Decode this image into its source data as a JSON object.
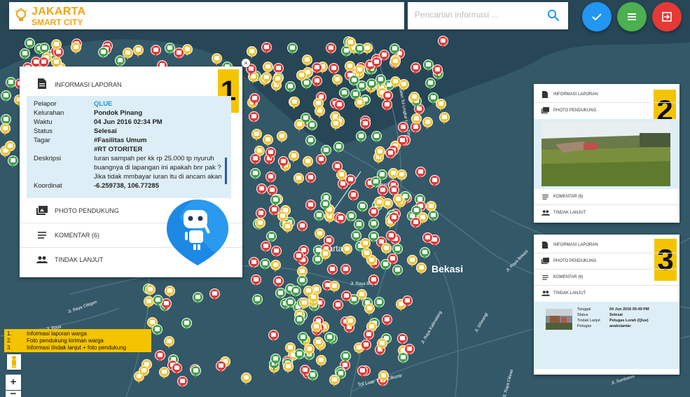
{
  "brand": {
    "title": "JAKARTA",
    "subtitle": "SMART CITY"
  },
  "search": {
    "placeholder": "Pencarian informasi ..."
  },
  "fabs": [
    {
      "name": "check-fab",
      "color": "#2196f3"
    },
    {
      "name": "menu-fab",
      "color": "#4caf50"
    },
    {
      "name": "logout-fab",
      "color": "#e53935"
    }
  ],
  "map_labels": {
    "city_center": "Jakarta",
    "bekasi": "Bekasi",
    "road_1": "Jl. Raya",
    "road_2": "Jl. Raya Bogor",
    "road_3": "Jl. Raya Cilegon",
    "road_4": "Tol Luar TMII-Cikunir",
    "road_5": "Jl. Raya Kalimalang",
    "road_6": "Jl. Sumbawa",
    "road_7": "Jl. Raya",
    "road_8": "Jl. Siliwangi",
    "road_9": "Jalan Tol Lingkar Luar Timur",
    "road_10": "Jl. Raya Bekasi",
    "road_11": "Jl. Raya Cikeas"
  },
  "popup": {
    "badge": "1",
    "header": "INFORMASI LAPORAN",
    "fields": [
      {
        "key": "Pelapor",
        "value": "QLUE"
      },
      {
        "key": "Kelurahan",
        "value": "Pondok Pinang"
      },
      {
        "key": "Waktu",
        "value": "04 Jun 2016 02:34 PM"
      },
      {
        "key": "Status",
        "value": "Selesai"
      },
      {
        "key": "Tagar",
        "value": "#Fasilitas Umum"
      },
      {
        "key": "",
        "value": "#RT OTORITER"
      },
      {
        "key": "Deskripsi",
        "value": "Iuran sampah per kk rp 25.000 tp nyuruh"
      },
      {
        "key": "",
        "value": "buangnya di lapangan ini apakah bnr pak ?"
      },
      {
        "key": "",
        "value": "Jika tidak mmbayar iuran itu di ancam akan"
      },
      {
        "key": "Koordinat",
        "value": "-6.259738, 106.77285"
      }
    ],
    "rows": [
      "PHOTO PENDUKUNG",
      "KOMENTAR (6)",
      "TINDAK LANJUT"
    ]
  },
  "panel2": {
    "badge": "2",
    "rows": [
      "INFORMASI LAPORAN",
      "PHOTO PENDUKUNG",
      "KOMENTAR (6)",
      "TINDAK LANJUT"
    ]
  },
  "panel3": {
    "badge": "3",
    "rows": [
      "INFORMASI LAPORAN",
      "PHOTO PENDUKUNG",
      "KOMENTAR (6)",
      "TINDAK LANJUT"
    ],
    "detail": [
      {
        "key": "Tanggal",
        "value": "04 Jun 2016 05:49 PM"
      },
      {
        "key": "Status",
        "value": "Selesai"
      },
      {
        "key": "Tindak Lanjut",
        "value": "Petugas Lurah (Qlue)"
      },
      {
        "key": "Petugas",
        "value": "anaksiantar"
      }
    ]
  },
  "legend": [
    {
      "num": "1.",
      "text": "Informasi laporan warga"
    },
    {
      "num": "2.",
      "text": "Foto pendukung kiriman warga"
    },
    {
      "num": "3.",
      "text": "Informasi tindak lanjut + foto pendukung"
    }
  ],
  "zoom": {
    "in": "+",
    "out": "−"
  }
}
